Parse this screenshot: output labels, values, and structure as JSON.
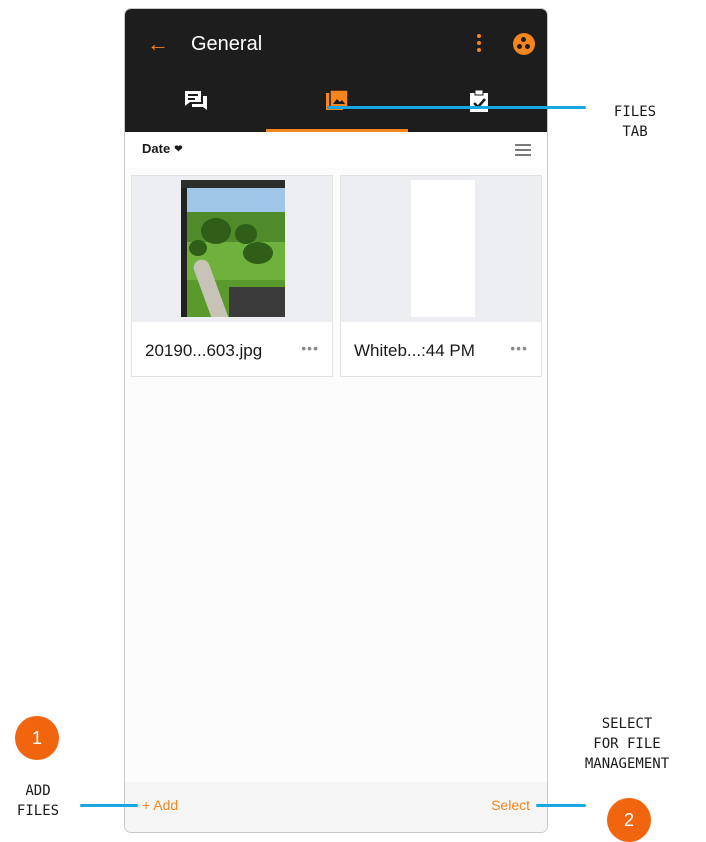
{
  "header": {
    "back_icon": "arrow-left-icon",
    "title": "General",
    "menu_icon": "more-vertical-icon",
    "group_icon": "team-avatar-icon"
  },
  "tabs": [
    {
      "name": "conversations",
      "icon": "chat-icon",
      "active": false
    },
    {
      "name": "files",
      "icon": "photo-library-icon",
      "active": true
    },
    {
      "name": "tasks",
      "icon": "clipboard-check-icon",
      "active": false
    }
  ],
  "sort": {
    "label": "Date",
    "view_icon": "list-view-icon"
  },
  "files": [
    {
      "name": "20190...603.jpg",
      "more": "•••"
    },
    {
      "name": "Whiteb...:44 PM",
      "more": "•••"
    }
  ],
  "footer": {
    "add_label": "+ Add",
    "select_label": "Select"
  },
  "annotations": {
    "files_tab": "FILES\nTAB",
    "add_files": "ADD\nFILES",
    "select_files": "SELECT\nFOR FILE\nMANAGEMENT",
    "badge_1": "1",
    "badge_2": "2"
  },
  "colors": {
    "accent": "#f5851f",
    "leader": "#1aa6e0",
    "badge": "#f0650e",
    "topbar": "#1d1d1d"
  }
}
